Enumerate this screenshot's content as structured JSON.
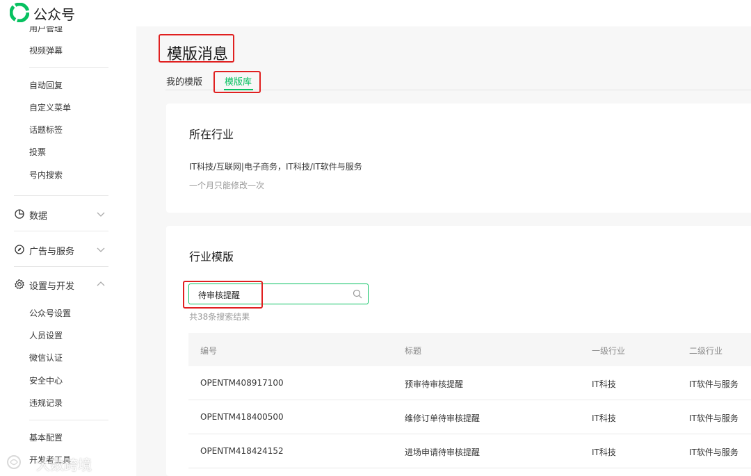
{
  "app": {
    "name": "公众号"
  },
  "sidebar": {
    "items_top": [
      {
        "label": "用户管理"
      },
      {
        "label": "视频弹幕"
      },
      {
        "label": "自动回复"
      },
      {
        "label": "自定义菜单"
      },
      {
        "label": "话题标签"
      },
      {
        "label": "投票"
      },
      {
        "label": "号内搜索"
      }
    ],
    "sections": [
      {
        "label": "数据",
        "icon": "pie-chart-icon",
        "expanded": false
      },
      {
        "label": "广告与服务",
        "icon": "compass-icon",
        "expanded": false
      },
      {
        "label": "设置与开发",
        "icon": "gear-icon",
        "expanded": true
      }
    ],
    "settings_items": [
      {
        "label": "公众号设置"
      },
      {
        "label": "人员设置"
      },
      {
        "label": "微信认证"
      },
      {
        "label": "安全中心"
      },
      {
        "label": "违规记录"
      },
      {
        "label": "基本配置"
      },
      {
        "label": "开发者工具"
      }
    ]
  },
  "main": {
    "title": "模版消息",
    "tabs": [
      {
        "label": "我的模版",
        "active": false
      },
      {
        "label": "模版库",
        "active": true
      }
    ],
    "industry_card": {
      "title": "所在行业",
      "value": "IT科技/互联网|电子商务，IT科技/IT软件与服务",
      "hint": "一个月只能修改一次"
    },
    "template_card": {
      "title": "行业模版",
      "search": {
        "value": "待审核提醒",
        "icon": "search-icon"
      },
      "result_count": "共38条搜索结果",
      "columns": [
        "编号",
        "标题",
        "一级行业",
        "二级行业"
      ],
      "rows": [
        {
          "id": "OPENTM408917100",
          "title": "预审待审核提醒",
          "industry1": "IT科技",
          "industry2": "IT软件与服务"
        },
        {
          "id": "OPENTM418400500",
          "title": "维修订单待审核提醒",
          "industry1": "IT科技",
          "industry2": "IT软件与服务"
        },
        {
          "id": "OPENTM418424152",
          "title": "进场申请待审核提醒",
          "industry1": "IT科技",
          "industry2": "IT软件与服务"
        }
      ]
    }
  },
  "watermark": {
    "text": "大数跨境"
  },
  "colors": {
    "accent": "#07c160",
    "annotation": "#e02020"
  }
}
